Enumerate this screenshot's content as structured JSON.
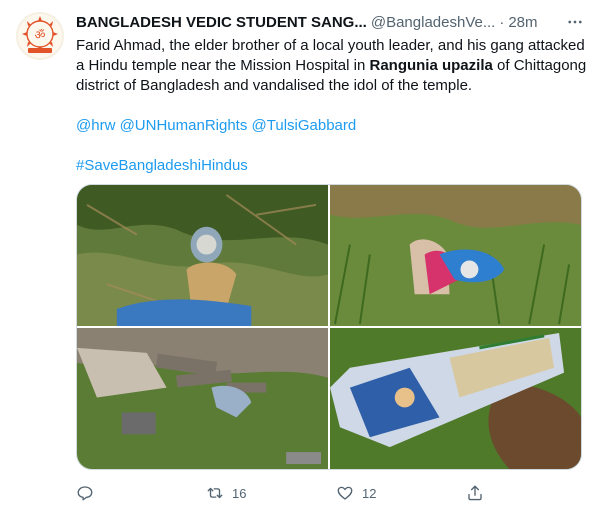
{
  "author": {
    "name": "BANGLADESH VEDIC STUDENT SANG...",
    "handle": "@BangladeshVe...",
    "time": "28m"
  },
  "tweet": {
    "text_part1": "Farid Ahmad, the elder brother of a local youth leader, and his gang attacked a Hindu temple near the Mission Hospital in ",
    "bold_place": "Rangunia upazila",
    "text_part2": " of Chittagong district of Bangladesh and vandalised the idol of the temple.",
    "mentions": [
      "@hrw",
      "@UNHumanRights",
      "@TulsiGabbard"
    ],
    "hashtag": "#SaveBangladeshiHindus"
  },
  "actions": {
    "reply_count": "",
    "retweet_count": "16",
    "like_count": "12",
    "share_label": ""
  },
  "icons": [
    "avatar-logo-icon",
    "more-icon",
    "reply-icon",
    "retweet-icon",
    "like-icon",
    "share-icon"
  ],
  "colors": {
    "link": "#1d9bf0",
    "secondary": "#536471",
    "accent_orange": "#e2532a"
  }
}
